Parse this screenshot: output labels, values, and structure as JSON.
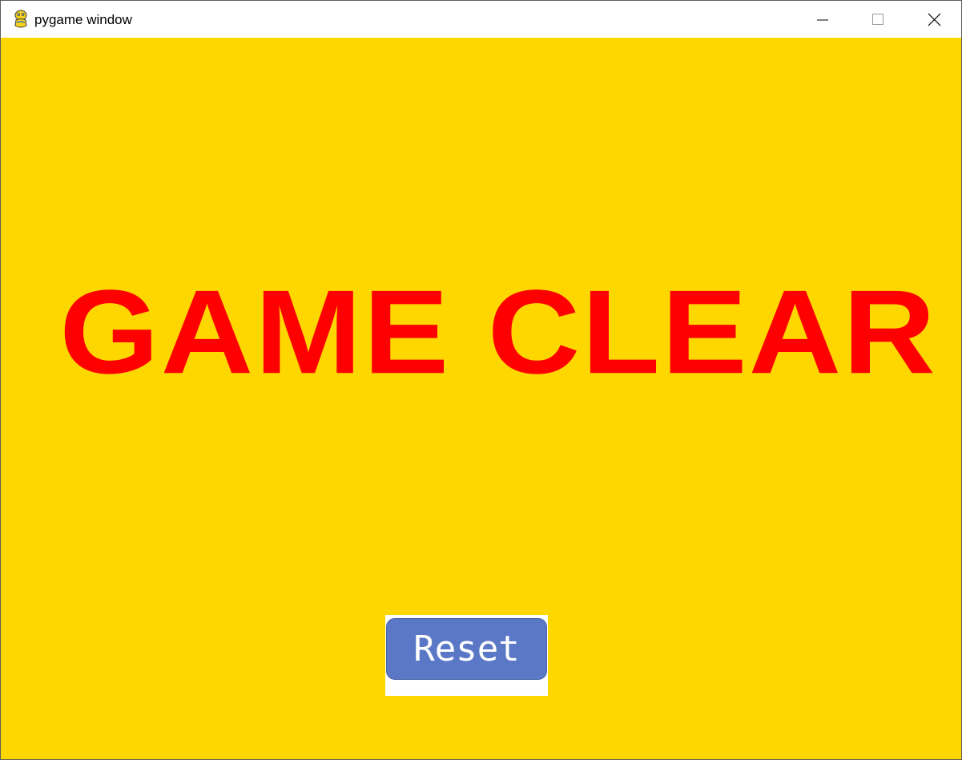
{
  "window": {
    "title": "pygame window",
    "app_icon": "pygame-snake-icon",
    "controls": {
      "minimize_icon": "minimize-icon",
      "maximize_icon": "maximize-icon",
      "close_icon": "close-icon"
    }
  },
  "game": {
    "message": "GAME CLEAR",
    "reset_label": "Reset",
    "colors": {
      "background": "#ffd700",
      "message": "#ff0000",
      "button": "#5a78c6",
      "button_text": "#ffffff"
    }
  }
}
